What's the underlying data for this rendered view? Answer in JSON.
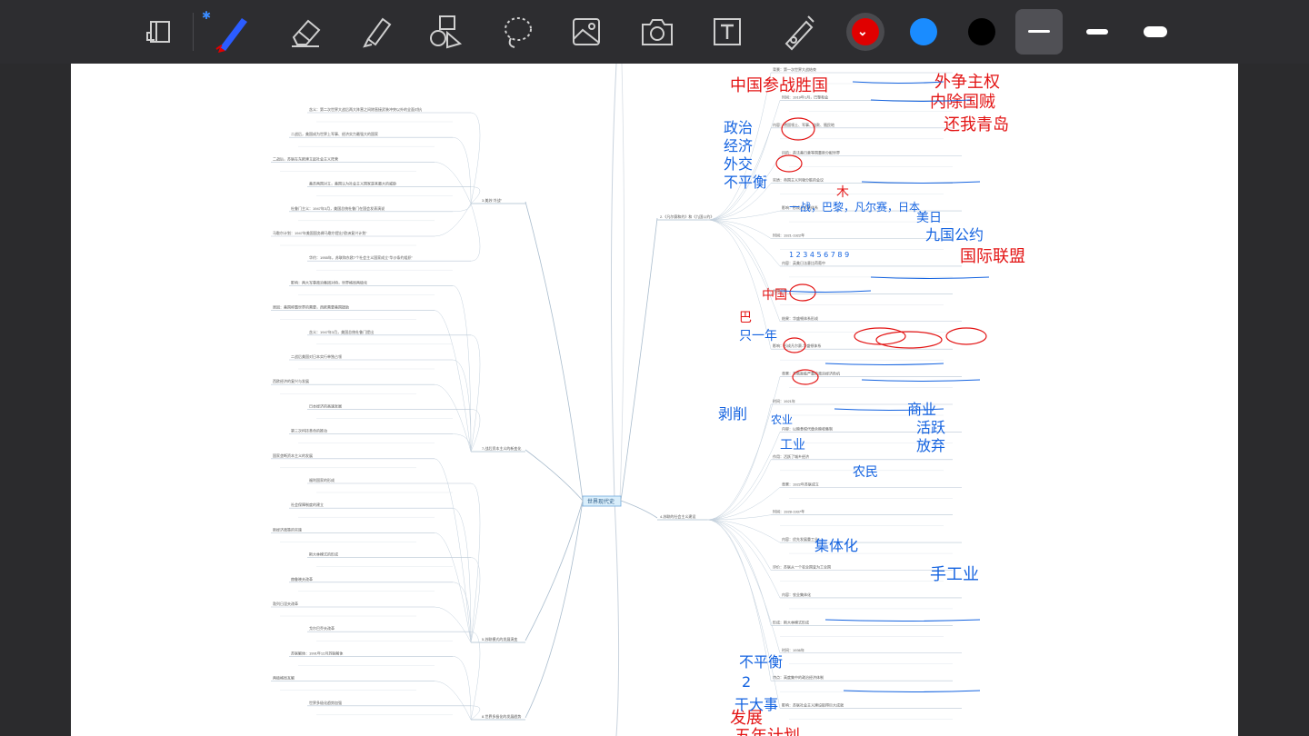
{
  "toolbar": {
    "tools": [
      {
        "name": "page-layout-icon",
        "label": "Page"
      },
      {
        "name": "pen-icon",
        "label": "Pen",
        "active": true
      },
      {
        "name": "eraser-icon",
        "label": "Eraser"
      },
      {
        "name": "highlighter-icon",
        "label": "Highlighter"
      },
      {
        "name": "shapes-icon",
        "label": "Shapes"
      },
      {
        "name": "lasso-icon",
        "label": "Lasso"
      },
      {
        "name": "image-icon",
        "label": "Image"
      },
      {
        "name": "camera-icon",
        "label": "Camera"
      },
      {
        "name": "text-box-icon",
        "label": "Text"
      },
      {
        "name": "laser-pointer-icon",
        "label": "Laser"
      }
    ],
    "bluetooth_glyph": "✱",
    "colors": [
      "#e00000",
      "#1a8cff",
      "#000000"
    ],
    "selected_color": "#e00000",
    "widths": [
      "thin",
      "medium",
      "thick"
    ],
    "selected_width": "thin"
  },
  "mindmap": {
    "root": "世界现代史",
    "left_branches": [
      "3.美苏“冷战”",
      "7.战后资本主义的新变化",
      "5.苏联模式的发展演变",
      "8.世界多极化的发展趋势"
    ],
    "right_branches": [
      "2.《凡尔赛和约》和《九国公约》",
      "4.苏联的社会主义建设"
    ],
    "left_notes": [
      "含义：第二次世界大战后两大阵营之间除直接武装冲突以外的全面对抗",
      "二战后，美国成为世界上军事、经济实力最强大的国家",
      "二战后，苏联在东欧建立起社会主义阵营",
      "美苏两国对立，美国认为社会主义国家是其最大的威胁",
      "杜鲁门主义：1947年3月，美国总统杜鲁门在国会发表演说",
      "马歇尔计划：1947年美国国务卿马歇尔提出“欧洲复兴计划”",
      "华约：1955年，苏联和东欧7个社会主义国家成立“华沙条约组织”",
      "影响：两大军事政治集团对峙，世界格局两极化",
      "原因：美国称霸世界的需要，西欧需要美国援助",
      "含义：1947年3月，美国总统杜鲁门提出",
      "二战后美国对日本实行单独占领",
      "西欧经济的复兴与发展",
      "日本经济的高速发展",
      "第三次科技革命的推动",
      "国家垄断资本主义的发展",
      "福利国家的形成",
      "社会保障制度的建立",
      "新经济政策的实施",
      "斯大林模式的形成",
      "赫鲁晓夫改革",
      "勃列日涅夫改革",
      "戈尔巴乔夫改革",
      "苏联解体：1991年12月苏联解体",
      "两极格局瓦解",
      "世界多极化趋势加强"
    ],
    "right_notes": [
      "背景：第一次世界大战结束",
      "时间：1919年1月，巴黎和会",
      "内容：德国领土、军事、赔款、殖民地",
      "目的：英法美日意等国重新分配世界",
      "实质：帝国主义列强分赃的会议",
      "影响：形成凡尔赛体系",
      "时间：1921-1922年",
      "内容：英美日法意比荷葡中",
      "九国公约",
      "结果：华盛顿体系形成",
      "影响：形成凡尔赛-华盛顿体系",
      "背景：苏俄面临严重的政治经济危机",
      "时间：1921年",
      "内容：以粮食税代替余粮收集制",
      "作用：活跃了城乡经济",
      "背景：1922年苏联成立",
      "时间：1928-1937年",
      "内容：优先发展重工业",
      "评价：苏联从一个农业国变为工业国",
      "内容：农业集体化",
      "形成：斯大林模式形成",
      "时间：1936年",
      "特点：高度集中的政治经济体制",
      "影响：苏联社会主义建设取得巨大成就"
    ]
  },
  "annotations": {
    "red": [
      "中国参战胜国",
      "外争主权",
      "内除国贼",
      "还我青岛",
      "木",
      "国际联盟",
      "中国",
      "巴",
      "发展",
      "五年计划"
    ],
    "blue": [
      "政治",
      "经济",
      "外交",
      "不平衡",
      "一战，巴黎，凡尔赛，日本",
      "美日",
      "1 2 3 4 5 6 7 8 9",
      "九国公约",
      "只一年",
      "剥削",
      "农业",
      "工业",
      "商业",
      "活跃",
      "放弃",
      "农民",
      "集体化",
      "手工业",
      "不平衡",
      "2",
      "干大事"
    ]
  }
}
